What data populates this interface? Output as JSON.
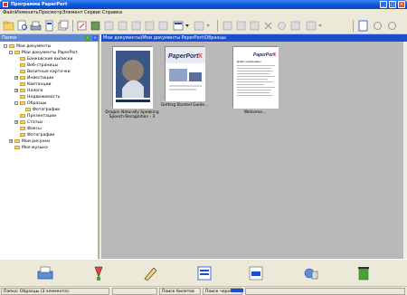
{
  "window": {
    "title": "Программа PaperPort"
  },
  "menu": [
    "Файл",
    "Изменить",
    "Просмотр",
    "Элемент",
    "Сервис",
    "Справка"
  ],
  "folders_header": "Папки",
  "tree": [
    {
      "label": "Мои документы",
      "expand": "-"
    },
    {
      "label": "Мои документы PaperPort",
      "expand": "-"
    },
    {
      "label": "Банковские выписки",
      "expand": ""
    },
    {
      "label": "Веб-страницы",
      "expand": ""
    },
    {
      "label": "Визитные карточки",
      "expand": ""
    },
    {
      "label": "Инвестиции",
      "expand": "+"
    },
    {
      "label": "Квитанции",
      "expand": ""
    },
    {
      "label": "Налоги",
      "expand": "+"
    },
    {
      "label": "Недвижимость",
      "expand": ""
    },
    {
      "label": "Образцы",
      "expand": "-"
    },
    {
      "label": "Фотографии",
      "expand": ""
    },
    {
      "label": "Презентации",
      "expand": ""
    },
    {
      "label": "Статьи",
      "expand": "+"
    },
    {
      "label": "Факсы",
      "expand": ""
    },
    {
      "label": "Фотографии",
      "expand": ""
    },
    {
      "label": "Мои рисунки",
      "expand": "+"
    },
    {
      "label": "Моя музыка",
      "expand": ""
    }
  ],
  "path": "Мои документы\\Мои документы PaperPort\\Образцы",
  "thumbnails": [
    {
      "caption": "Dragon Naturally Speaking Speech Recognition - 3"
    },
    {
      "caption": "Getting Started Guide..."
    },
    {
      "caption": "Welcome..."
    }
  ],
  "thumb2_logo": "PaperPort",
  "thumb2_logo_suffix": "X",
  "thumb3_logo": "PaperPort",
  "thumb3_logo_suffix": "X",
  "thumb3_heading": "Добро пожаловать!",
  "status": {
    "folder": "Папка: Образцы (3 элемента).",
    "search_similar": "Поиск билетов",
    "search_text": "Поиск черного"
  },
  "colors": {
    "titlebar": "#0a52d8",
    "accent": "#1c4fcf",
    "content_bg": "#b9b9b9"
  },
  "icons": [
    "folder-icon",
    "scan-icon",
    "print-icon",
    "mail-icon",
    "ftp-icon",
    "ocr-icon",
    "recycle-icon"
  ]
}
